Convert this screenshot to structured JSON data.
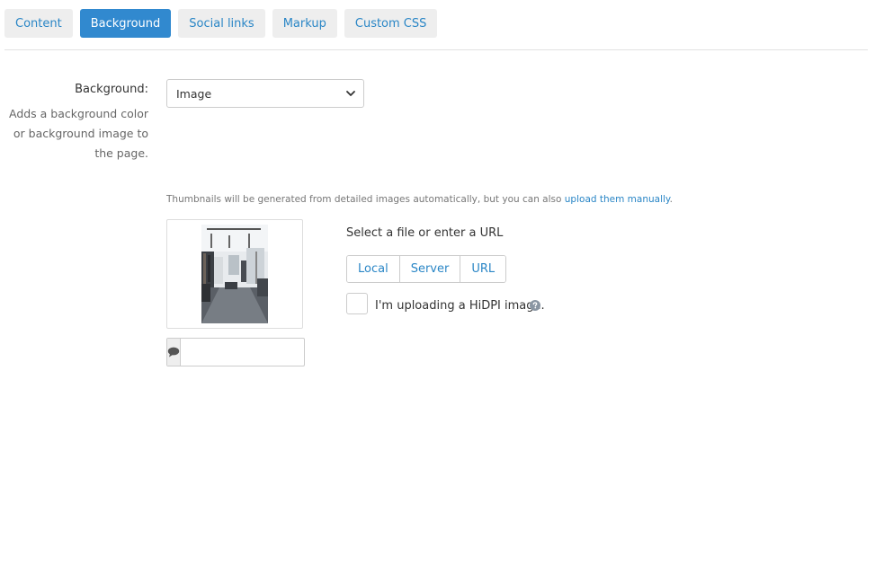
{
  "tabs": [
    {
      "label": "Content",
      "active": false
    },
    {
      "label": "Background",
      "active": true
    },
    {
      "label": "Social links",
      "active": false
    },
    {
      "label": "Markup",
      "active": false
    },
    {
      "label": "Custom CSS",
      "active": false
    }
  ],
  "background_field": {
    "label": "Background:",
    "help_lines": [
      "Adds a background color",
      "or background image to",
      "the page."
    ],
    "selected_value": "Image"
  },
  "thumbnails": {
    "note": "Thumbnails will be generated from detailed images automatically, but you can also",
    "link_text": "upload them manually",
    "note_end": "."
  },
  "image_preview": {
    "alt_placeholder": "",
    "comment_icon": "comment-icon"
  },
  "file_selector": {
    "title": "Select a file or enter a URL",
    "sources": [
      "Local",
      "Server",
      "URL"
    ],
    "hidpi_label": "I'm uploading a HiDPI image.",
    "hidpi_checked": false,
    "help_icon": "question-circle-icon"
  },
  "colors": {
    "accent": "#3189cf",
    "link": "#2a86c6"
  }
}
